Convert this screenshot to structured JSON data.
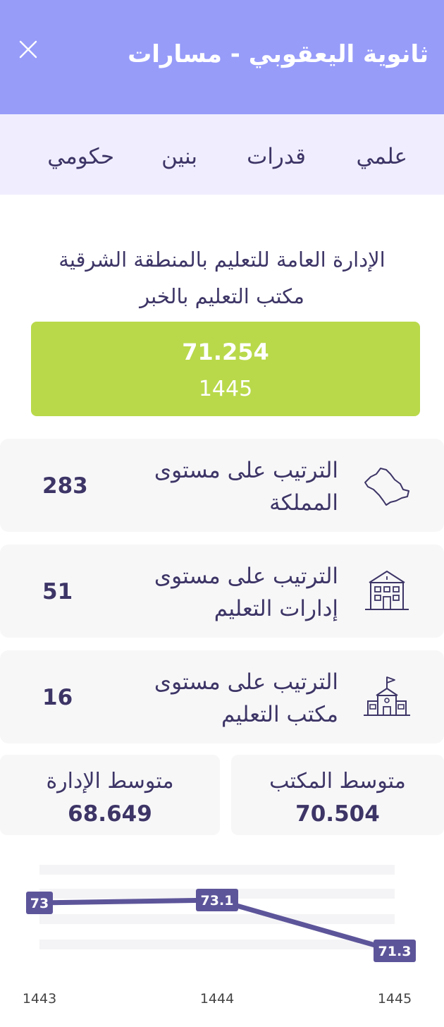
{
  "header": {
    "title": "ثانوية اليعقوبي - مسارات"
  },
  "tags": [
    "علمي",
    "قدرات",
    "بنين",
    "حكومي"
  ],
  "region": {
    "administration": "الإدارة العامة للتعليم بالمنطقة الشرقية",
    "office": "مكتب التعليم بالخبر"
  },
  "score": {
    "value": "71.254",
    "year": "1445"
  },
  "rankings": [
    {
      "label": "الترتيب على مستوى المملكة",
      "value": "283",
      "icon": "saudi-map-icon"
    },
    {
      "label": "الترتيب على مستوى إدارات التعليم",
      "value": "51",
      "icon": "building-icon"
    },
    {
      "label": "الترتيب على مستوى مكتب التعليم",
      "value": "16",
      "icon": "school-flag-icon"
    }
  ],
  "averages": {
    "office_label": "متوسط المكتب",
    "office_value": "70.504",
    "admin_label": "متوسط الإدارة",
    "admin_value": "68.649"
  },
  "colors": {
    "header": "#979cf9",
    "tags_bg": "#f0eefe",
    "score_card": "#b9d94a",
    "text": "#3d3566",
    "line": "#5d559a",
    "card_bg": "#f7f7f8"
  },
  "chart_data": {
    "type": "line",
    "x": [
      "1443",
      "1444",
      "1445"
    ],
    "series": [
      {
        "values": [
          73,
          73.1,
          71.3
        ]
      }
    ],
    "point_labels": [
      "73",
      "73.1",
      "71.3"
    ]
  }
}
